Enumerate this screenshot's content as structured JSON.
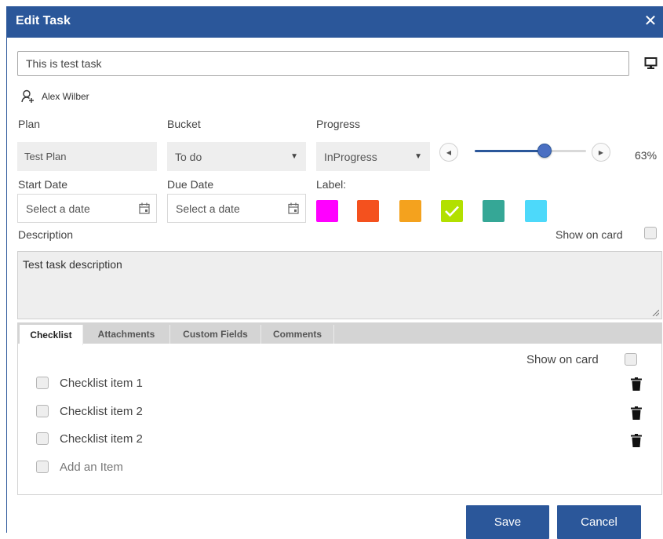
{
  "dialog": {
    "title": "Edit Task",
    "close_glyph": "✕"
  },
  "task": {
    "title_value": "This is test task",
    "assignee": "Alex Wilber"
  },
  "fields": {
    "plan_label": "Plan",
    "plan_value": "Test Plan",
    "bucket_label": "Bucket",
    "bucket_value": "To do",
    "progress_label": "Progress",
    "progress_value": "InProgress",
    "progress_percent": 63,
    "progress_percent_text": "63%",
    "start_date_label": "Start Date",
    "start_date_placeholder": "Select a date",
    "due_date_label": "Due Date",
    "due_date_placeholder": "Select a date",
    "label_label": "Label:"
  },
  "labels": [
    {
      "color": "#ff00ff",
      "checked": false
    },
    {
      "color": "#f4511e",
      "checked": false
    },
    {
      "color": "#f4a21e",
      "checked": false
    },
    {
      "color": "#b2e000",
      "checked": true
    },
    {
      "color": "#35a796",
      "checked": false
    },
    {
      "color": "#4dd9fa",
      "checked": false
    }
  ],
  "description": {
    "label": "Description",
    "show_on_card": "Show on card",
    "value": "Test task description"
  },
  "tabs": [
    {
      "label": "Checklist",
      "active": true
    },
    {
      "label": "Attachments",
      "active": false
    },
    {
      "label": "Custom Fields",
      "active": false
    },
    {
      "label": "Comments",
      "active": false
    }
  ],
  "checklist": {
    "show_on_card": "Show on card",
    "items": [
      {
        "label": "Checklist item 1"
      },
      {
        "label": "Checklist item 2"
      },
      {
        "label": "Checklist item 2"
      }
    ],
    "add_placeholder": "Add an Item"
  },
  "buttons": {
    "save": "Save",
    "cancel": "Cancel"
  },
  "colors": {
    "brand": "#2b579a",
    "field_bg": "#eeeeee"
  }
}
